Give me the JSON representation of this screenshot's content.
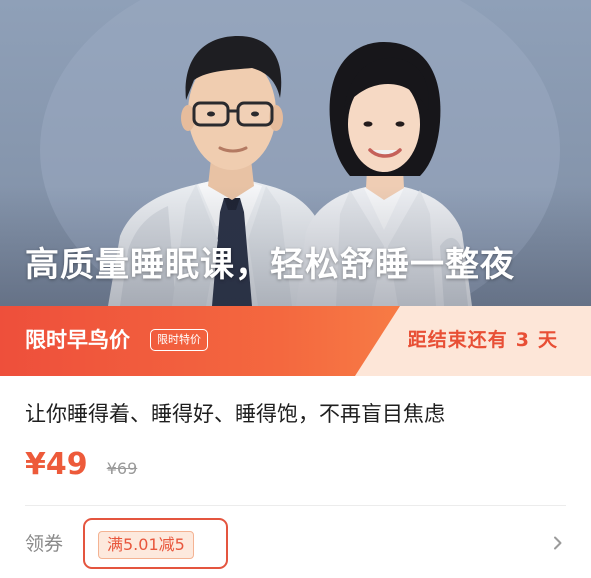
{
  "hero": {
    "title": "高质量睡眠课，轻松舒睡一整夜"
  },
  "promo": {
    "label": "限时早鸟价",
    "tag": "限时特价",
    "countdown_prefix": "距结束还有",
    "countdown_value": "3",
    "countdown_unit": "天"
  },
  "product": {
    "title": "让你睡得着、睡得好、睡得饱，不再盲目焦虑",
    "price_current": "¥49",
    "price_original": "¥69"
  },
  "coupon": {
    "label": "领券",
    "offer": "满5.01减5",
    "arrow_icon": "chevron-right-icon"
  },
  "colors": {
    "accent": "#ED5A3A",
    "banner_light": "#FDE6D8",
    "hero_bg": "#8A9AB0"
  }
}
